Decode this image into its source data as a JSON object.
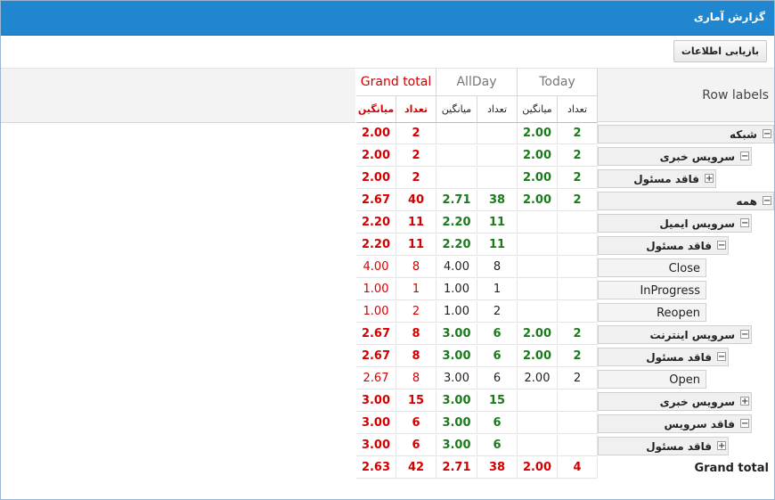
{
  "window": {
    "title": "گزارش آماری"
  },
  "toolbar": {
    "restore_label": "بازیابی اطلاعات"
  },
  "header": {
    "row_labels": "Row labels",
    "groups": [
      {
        "label": "Today",
        "count": "تعداد",
        "avg": "میانگین"
      },
      {
        "label": "AllDay",
        "count": "تعداد",
        "avg": "میانگین"
      },
      {
        "label": "Grand total",
        "count": "تعداد",
        "avg": "میانگین"
      }
    ]
  },
  "rows": [
    {
      "label": "شبکه",
      "toggle": "−",
      "today_count": "2",
      "today_avg": "2.00",
      "all_count": "",
      "all_avg": "",
      "gt_count": "2",
      "gt_avg": "2.00"
    },
    {
      "label": "سرویس خبری",
      "toggle": "−",
      "today_count": "2",
      "today_avg": "2.00",
      "all_count": "",
      "all_avg": "",
      "gt_count": "2",
      "gt_avg": "2.00"
    },
    {
      "label": "فاقد مسئول",
      "toggle": "+",
      "today_count": "2",
      "today_avg": "2.00",
      "all_count": "",
      "all_avg": "",
      "gt_count": "2",
      "gt_avg": "2.00"
    },
    {
      "label": "همه",
      "toggle": "−",
      "today_count": "2",
      "today_avg": "2.00",
      "all_count": "38",
      "all_avg": "2.71",
      "gt_count": "40",
      "gt_avg": "2.67"
    },
    {
      "label": "سرویس ایمیل",
      "toggle": "−",
      "today_count": "",
      "today_avg": "",
      "all_count": "11",
      "all_avg": "2.20",
      "gt_count": "11",
      "gt_avg": "2.20"
    },
    {
      "label": "فاقد مسئول",
      "toggle": "−",
      "today_count": "",
      "today_avg": "",
      "all_count": "11",
      "all_avg": "2.20",
      "gt_count": "11",
      "gt_avg": "2.20"
    },
    {
      "label": "Close",
      "toggle": "",
      "today_count": "",
      "today_avg": "",
      "all_count": "8",
      "all_avg": "4.00",
      "gt_count": "8",
      "gt_avg": "4.00"
    },
    {
      "label": "InProgress",
      "toggle": "",
      "today_count": "",
      "today_avg": "",
      "all_count": "1",
      "all_avg": "1.00",
      "gt_count": "1",
      "gt_avg": "1.00"
    },
    {
      "label": "Reopen",
      "toggle": "",
      "today_count": "",
      "today_avg": "",
      "all_count": "2",
      "all_avg": "1.00",
      "gt_count": "2",
      "gt_avg": "1.00"
    },
    {
      "label": "سرویس اینترنت",
      "toggle": "−",
      "today_count": "2",
      "today_avg": "2.00",
      "all_count": "6",
      "all_avg": "3.00",
      "gt_count": "8",
      "gt_avg": "2.67"
    },
    {
      "label": "فاقد مسئول",
      "toggle": "−",
      "today_count": "2",
      "today_avg": "2.00",
      "all_count": "6",
      "all_avg": "3.00",
      "gt_count": "8",
      "gt_avg": "2.67"
    },
    {
      "label": "Open",
      "toggle": "",
      "today_count": "2",
      "today_avg": "2.00",
      "all_count": "6",
      "all_avg": "3.00",
      "gt_count": "8",
      "gt_avg": "2.67"
    },
    {
      "label": "سرویس خبری",
      "toggle": "+",
      "today_count": "",
      "today_avg": "",
      "all_count": "15",
      "all_avg": "3.00",
      "gt_count": "15",
      "gt_avg": "3.00"
    },
    {
      "label": "فاقد سرویس",
      "toggle": "−",
      "today_count": "",
      "today_avg": "",
      "all_count": "6",
      "all_avg": "3.00",
      "gt_count": "6",
      "gt_avg": "3.00"
    },
    {
      "label": "فاقد مسئول",
      "toggle": "+",
      "today_count": "",
      "today_avg": "",
      "all_count": "6",
      "all_avg": "3.00",
      "gt_count": "6",
      "gt_avg": "3.00"
    },
    {
      "label": "Grand total",
      "toggle": "",
      "today_count": "4",
      "today_avg": "2.00",
      "all_count": "38",
      "all_avg": "2.71",
      "gt_count": "42",
      "gt_avg": "2.63"
    }
  ]
}
